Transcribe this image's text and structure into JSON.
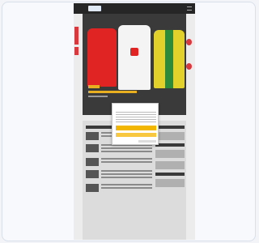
{
  "consent_dialog": {
    "title": "",
    "accept_label": "",
    "reject_label": "",
    "settings_label": ""
  },
  "colors": {
    "accent_red": "#d8393e",
    "accept_yellow": "#f2b600",
    "topbar": "#262626"
  }
}
